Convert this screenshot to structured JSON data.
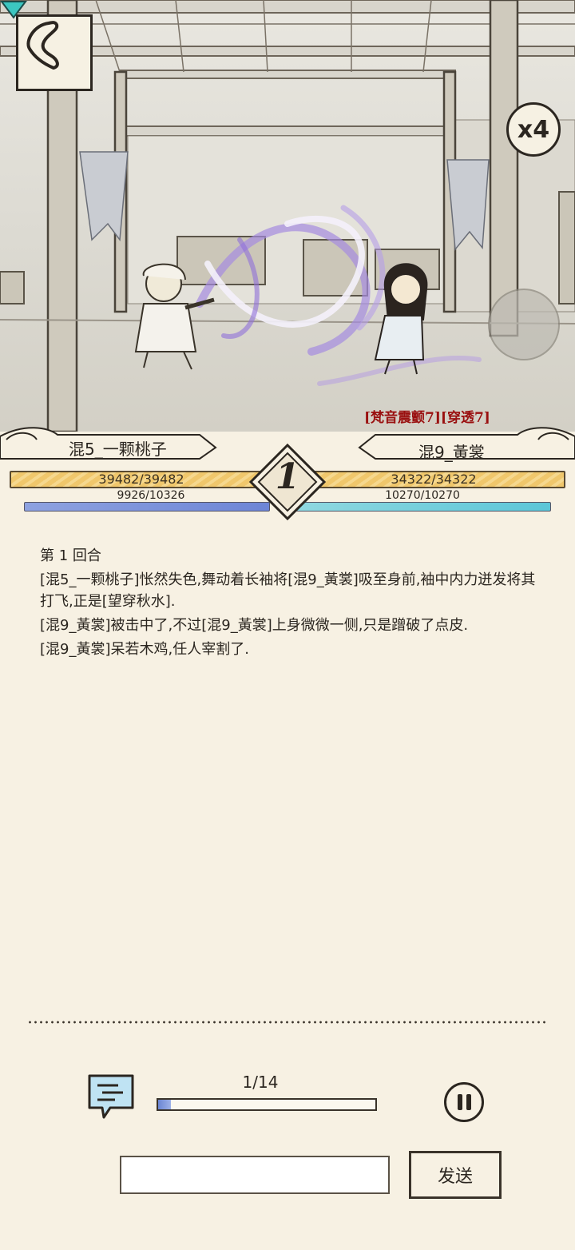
{
  "battle": {
    "speed_label": "x4",
    "buff_text": "[梵音震颤7][穿透7]",
    "round_number": "1"
  },
  "left_fighter": {
    "name": "混5_一颗桃子",
    "hp_text": "39482/39482",
    "mp_text": "9926/10326",
    "mp_fraction": 0.961
  },
  "right_fighter": {
    "name": "混9_黃裳",
    "hp_text": "34322/34322",
    "mp_text": "10270/10270",
    "mp_fraction": 1.0
  },
  "log": {
    "round_title": "第 1 回合",
    "lines": [
      "[混5_一颗桃子]怅然失色,舞动着长袖将[混9_黃裳]吸至身前,袖中内力迸发将其打飞,正是[望穿秋水].",
      "[混9_黃裳]被击中了,不过[混9_黃裳]上身微微一侧,只是蹭破了点皮.",
      "[混9_黃裳]呆若木鸡,任人宰割了."
    ]
  },
  "playback": {
    "progress_label": "1/14",
    "current": 1,
    "total": 14
  },
  "chat": {
    "input_value": "",
    "send_label": "发送"
  },
  "colors": {
    "background": "#f7f1e3",
    "hp_bar": "#f0c76c",
    "mp_left": "#6d85d6",
    "mp_right": "#5bc6d8",
    "buff_text": "#9a1010"
  },
  "icons": [
    "back-icon",
    "speed-icon",
    "target-marker-icon",
    "chat-icon",
    "pause-icon"
  ]
}
